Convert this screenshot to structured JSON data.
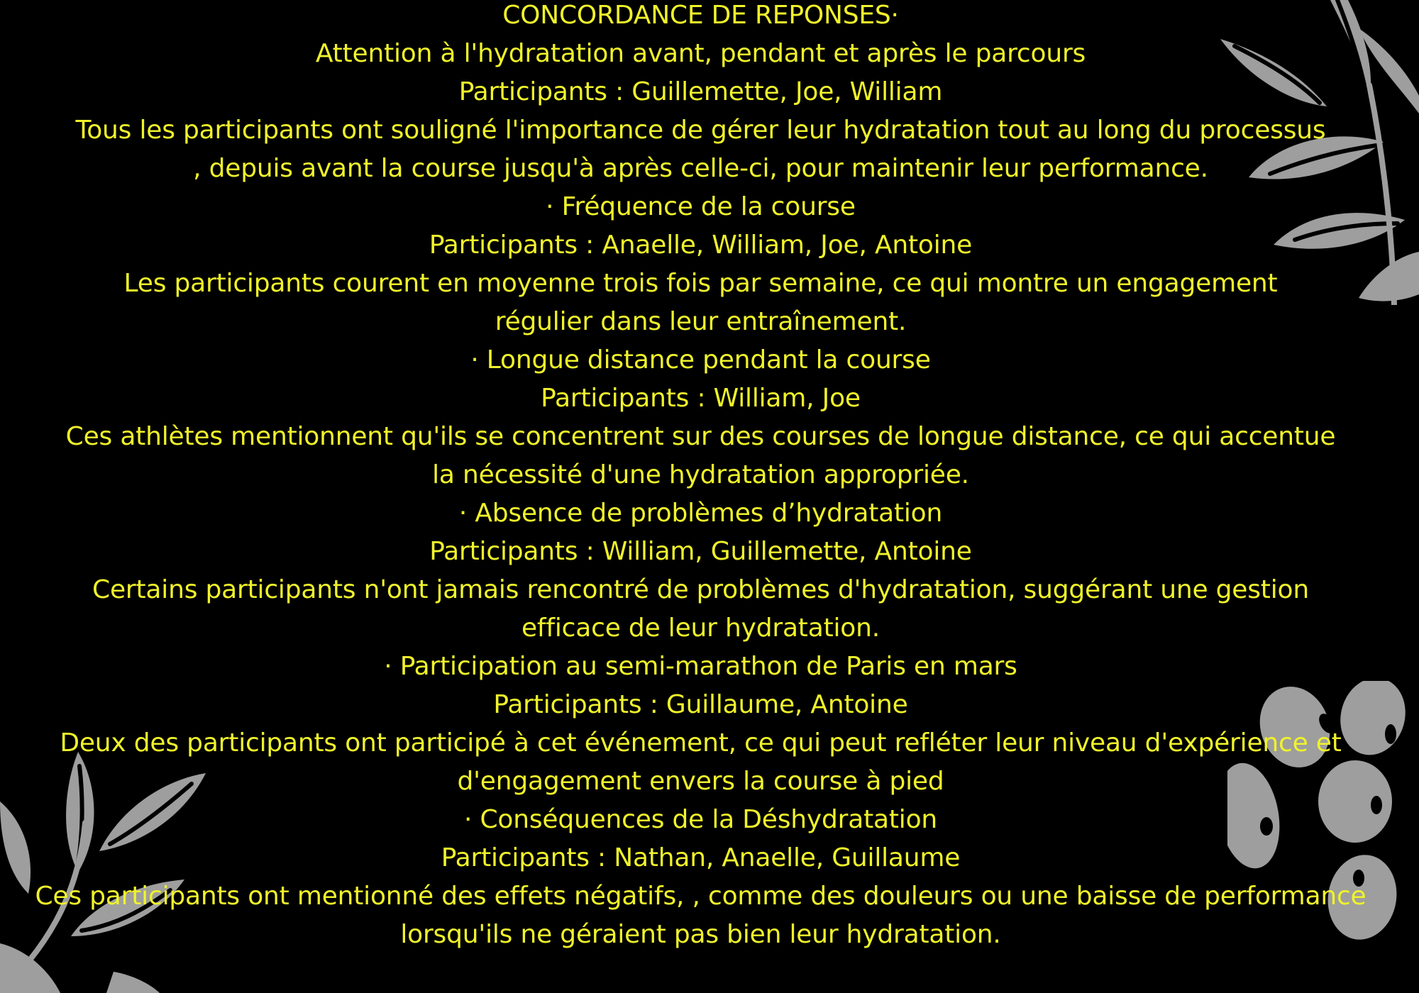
{
  "colors": {
    "background": "#000000",
    "text": "#f0f32a",
    "decoration": "#9e9e9e"
  },
  "document": {
    "lines": [
      "CONCORDANCE DE REPONSES·",
      "Attention à l'hydratation avant, pendant et après le parcours",
      "Participants : Guillemette, Joe, William",
      "Tous les participants ont souligné l'importance de gérer leur hydratation tout au long du processus",
      ", depuis avant la course jusqu'à après celle-ci, pour maintenir leur performance.",
      "· Fréquence de la course",
      "Participants : Anaelle, William, Joe, Antoine",
      "Les participants courent en moyenne trois fois par semaine, ce qui montre un engagement",
      "régulier dans leur entraînement.",
      "· Longue distance pendant la course",
      "Participants : William, Joe",
      "Ces athlètes mentionnent qu'ils se concentrent sur des courses de longue distance, ce qui accentue",
      "la nécessité d'une hydratation appropriée.",
      "· Absence de problèmes d’hydratation",
      "Participants : William, Guillemette, Antoine",
      "Certains participants n'ont jamais rencontré de problèmes d'hydratation, suggérant une gestion",
      "efficace de leur hydratation.",
      "· Participation au semi-marathon de Paris en mars",
      "Participants : Guillaume, Antoine",
      "Deux des participants ont participé à cet événement, ce qui peut refléter leur niveau d'expérience et",
      "d'engagement envers la course à pied",
      "· Conséquences de la Déshydratation",
      "Participants : Nathan, Anaelle, Guillaume",
      "Ces participants ont mentionné des effets négatifs, , comme des douleurs ou une baisse de performance",
      "lorsqu'ils ne géraient pas bien leur hydratation."
    ]
  },
  "decorations": {
    "top_right": "leaf-branch-icon",
    "bottom_left": "leaf-branch-icon",
    "bottom_right": "berries-icon"
  }
}
